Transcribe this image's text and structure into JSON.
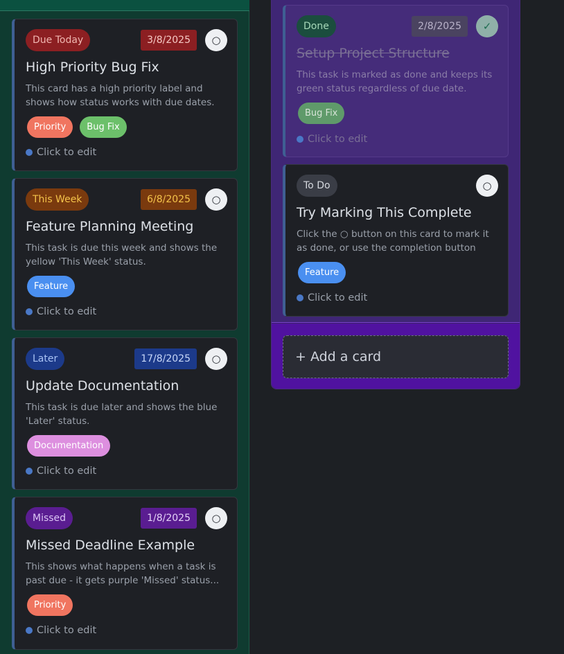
{
  "columns": {
    "left": {
      "cards": [
        {
          "status": "Due Today",
          "date": "3/8/2025",
          "title": "High Priority Bug Fix",
          "description": "This card has a high priority label and shows how status works with due dates.",
          "tags": [
            "Priority",
            "Bug Fix"
          ],
          "edit_label": "Click to edit",
          "check_glyph": "○"
        },
        {
          "status": "This Week",
          "date": "6/8/2025",
          "title": "Feature Planning Meeting",
          "description": "This task is due this week and shows the yellow 'This Week' status.",
          "tags": [
            "Feature"
          ],
          "edit_label": "Click to edit",
          "check_glyph": "○"
        },
        {
          "status": "Later",
          "date": "17/8/2025",
          "title": "Update Documentation",
          "description": "This task is due later and shows the blue 'Later' status.",
          "tags": [
            "Documentation"
          ],
          "edit_label": "Click to edit",
          "check_glyph": "○"
        },
        {
          "status": "Missed",
          "date": "1/8/2025",
          "title": "Missed Deadline Example",
          "description": "This shows what happens when a task is past due - it gets purple 'Missed' status...",
          "tags": [
            "Priority"
          ],
          "edit_label": "Click to edit",
          "check_glyph": "○"
        }
      ]
    },
    "right": {
      "cards": [
        {
          "status": "Done",
          "date": "2/8/2025",
          "title": "Setup Project Structure",
          "description": "This task is marked as done and keeps its green status regardless of due date. Notic...",
          "tags": [
            "Bug Fix"
          ],
          "edit_label": "Click to edit",
          "check_glyph": "✓"
        },
        {
          "status": "To Do",
          "title": "Try Marking This Complete",
          "description": "Click the ○ button on this card to mark it as done, or use the completion button in...",
          "tags": [
            "Feature"
          ],
          "edit_label": "Click to edit",
          "check_glyph": "○"
        }
      ],
      "add_card_label": "+ Add a card"
    }
  },
  "colors": {
    "due_today": "#8c1f22",
    "this_week": "#7a3a0e",
    "later": "#1c3a8a",
    "missed": "#5a1d91",
    "done_status": "#1b4d3e",
    "todo_status": "#3a3d46",
    "tag_priority": "#f07560",
    "tag_bugfix": "#6cc06a",
    "tag_feature": "#4a8ff0",
    "tag_documentation": "#dd8fdf"
  }
}
